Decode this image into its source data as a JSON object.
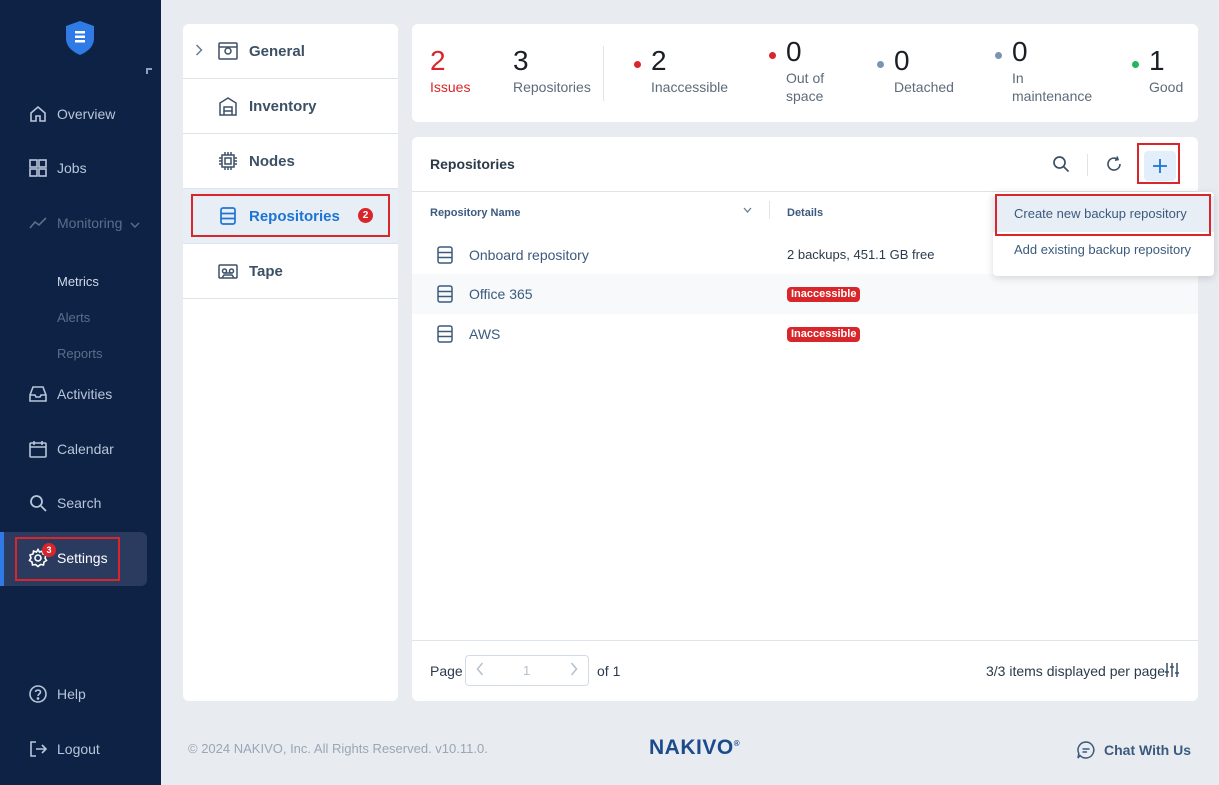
{
  "sidebar": {
    "items": [
      {
        "label": "Overview"
      },
      {
        "label": "Jobs"
      },
      {
        "label": "Monitoring"
      },
      {
        "label": "Activities"
      },
      {
        "label": "Calendar"
      },
      {
        "label": "Search"
      },
      {
        "label": "Settings",
        "badge": "3"
      },
      {
        "label": "Help"
      },
      {
        "label": "Logout"
      }
    ],
    "monitoring_sub": [
      "Metrics",
      "Alerts",
      "Reports"
    ]
  },
  "settings_menu": {
    "items": [
      {
        "label": "General",
        "icon": "general-settings-icon"
      },
      {
        "label": "Inventory",
        "icon": "inventory-icon"
      },
      {
        "label": "Nodes",
        "icon": "node-chip-icon"
      },
      {
        "label": "Repositories",
        "icon": "repository-icon",
        "badge": "2",
        "active": true
      },
      {
        "label": "Tape",
        "icon": "tape-icon"
      }
    ]
  },
  "summary": {
    "issues": {
      "value": "2",
      "label": "Issues"
    },
    "repositories": {
      "value": "3",
      "label": "Repositories"
    },
    "inaccessible": {
      "value": "2",
      "label": "Inaccessible"
    },
    "out_of_space": {
      "value": "0",
      "label_line1": "Out of",
      "label_line2": "space"
    },
    "detached": {
      "value": "0",
      "label": "Detached"
    },
    "in_maintenance": {
      "value": "0",
      "label_line1": "In",
      "label_line2": "maintenance"
    },
    "good": {
      "value": "1",
      "label": "Good"
    }
  },
  "main": {
    "title": "Repositories",
    "columns": {
      "name": "Repository Name",
      "details": "Details"
    },
    "rows": [
      {
        "name": "Onboard repository",
        "details": "2 backups, 451.1 GB free"
      },
      {
        "name": "Office 365",
        "status": "Inaccessible"
      },
      {
        "name": "AWS",
        "status": "Inaccessible"
      }
    ],
    "pager": {
      "label": "Page",
      "current": "1",
      "of": "of 1"
    },
    "per_page": "3/3 items displayed per page"
  },
  "dropdown": {
    "items": [
      "Create new backup repository",
      "Add existing backup repository"
    ]
  },
  "footer": {
    "copyright": "© 2024 NAKIVO, Inc. All Rights Reserved. v10.11.0.",
    "brand": "NAKIVO",
    "brand_mark": "®",
    "chat": "Chat With Us"
  },
  "colors": {
    "sidebar_bg": "#0d2244",
    "accent": "#1c74d4",
    "error": "#d9262b",
    "good": "#1fb85c"
  }
}
